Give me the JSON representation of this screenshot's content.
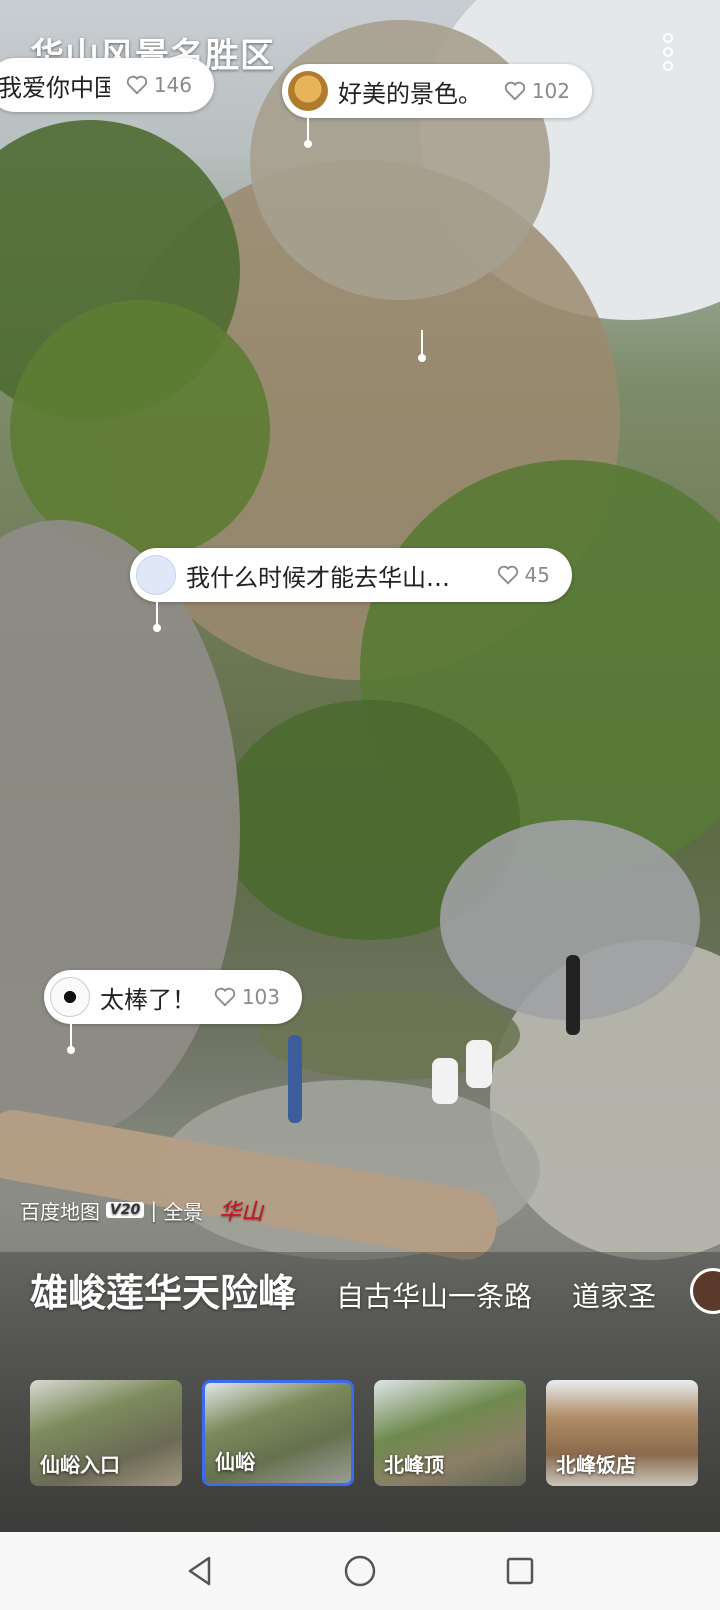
{
  "app": {
    "title": "华山风景名胜区"
  },
  "comments": [
    {
      "text": "我爱你中国",
      "likes": "146",
      "avatar": "none"
    },
    {
      "text": "好美的景色。",
      "likes": "102",
      "avatar": "dog-avatar"
    },
    {
      "text": "我什么时候才能去华山…",
      "likes": "45",
      "avatar": "default-user-avatar"
    },
    {
      "text": "太棒了！",
      "likes": "103",
      "avatar": "soccer-ball-avatar"
    }
  ],
  "watermark": {
    "brand": "百度地图",
    "badge": "V20",
    "divider": "|",
    "mode": "全景",
    "signature": "华山"
  },
  "tabs": [
    {
      "label": "雄峻莲华天险峰",
      "active": true
    },
    {
      "label": "自古华山一条路",
      "active": false
    },
    {
      "label": "道家圣"
    }
  ],
  "thumbnails": [
    {
      "label": "仙峪入口",
      "selected": false
    },
    {
      "label": "仙峪",
      "selected": true
    },
    {
      "label": "北峰顶",
      "selected": false
    },
    {
      "label": "北峰饭店",
      "selected": false
    }
  ],
  "colors": {
    "accent": "#3a6bf0",
    "bubble_bg": "#ffffff",
    "signature": "#c8102e"
  },
  "icons": {
    "more": "more-vertical-icon",
    "like": "heart-outline-icon",
    "nav_back": "triangle-back-icon",
    "nav_home": "circle-home-icon",
    "nav_recent": "square-recent-icon"
  }
}
